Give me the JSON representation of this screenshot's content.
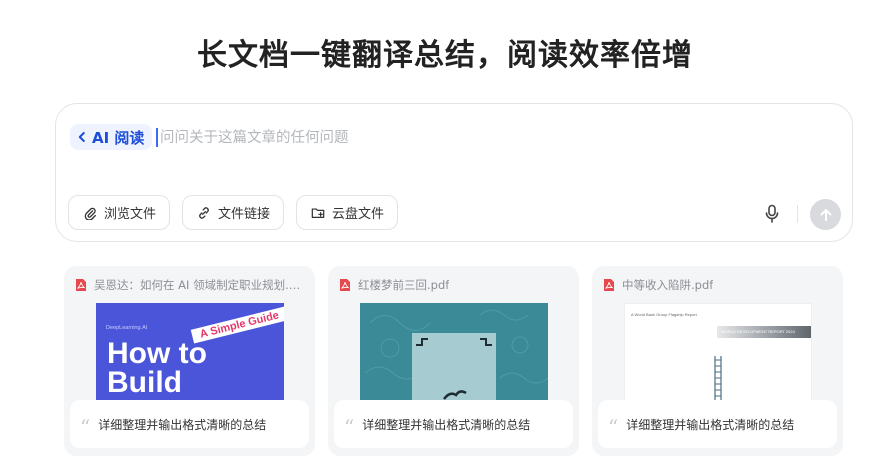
{
  "headline": "长文档一键翻译总结，阅读效率倍增",
  "ask": {
    "mode_label": "AI 阅读",
    "placeholder": "问问关于这篇文章的任何问题",
    "buttons": {
      "browse": "浏览文件",
      "link": "文件链接",
      "cloud": "云盘文件"
    }
  },
  "cards": [
    {
      "file_name": "吴恩达：如何在 AI 领域制定职业规划.pdf",
      "prompt": "详细整理并输出格式清晰的总结",
      "thumb": {
        "brand": "DeepLearning.AI",
        "ribbon": "A Simple Guide",
        "title_line1": "How to",
        "title_line2": "Build"
      }
    },
    {
      "file_name": "红楼梦前三回.pdf",
      "prompt": "详细整理并输出格式清晰的总结"
    },
    {
      "file_name": "中等收入陷阱.pdf",
      "prompt": "详细整理并输出格式清晰的总结",
      "thumb": {
        "small_text": "A World Bank Group Flagship Report",
        "banner_text": "WORLD DEVELOPMENT REPORT 2024"
      }
    }
  ],
  "colors": {
    "accent": "#1d4ed8",
    "chip_bg": "#eef3ff",
    "pdf_red": "#e5484d",
    "send_disabled": "#d9dade"
  },
  "icons": {
    "mode_back": "chevron-left-icon",
    "browse": "paperclip-icon",
    "link": "link-icon",
    "cloud": "cloud-folder-icon",
    "mic": "microphone-icon",
    "send": "arrow-up-icon",
    "file": "pdf-icon",
    "prompt": "quote-icon"
  }
}
